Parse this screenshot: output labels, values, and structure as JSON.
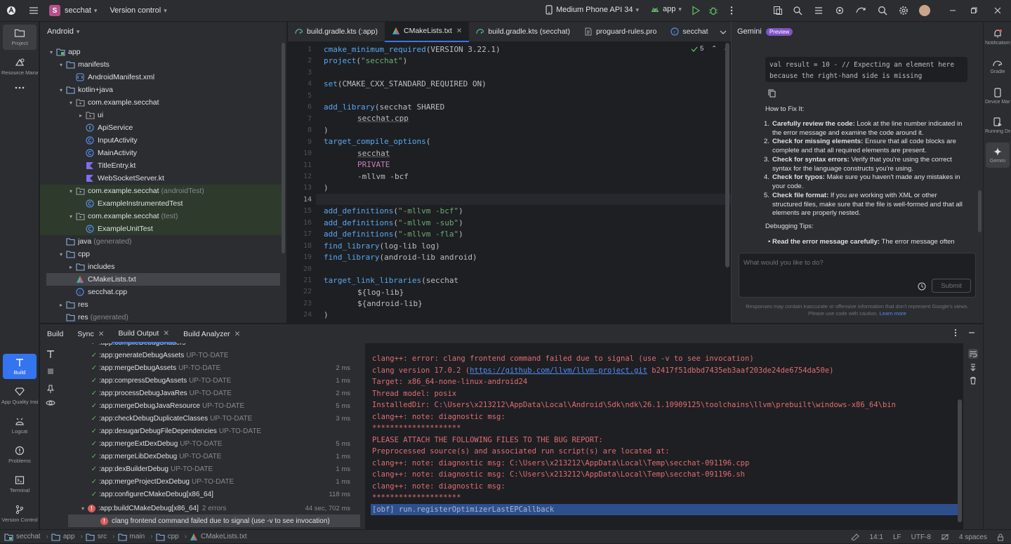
{
  "titlebar": {
    "project_initial": "S",
    "project_name": "secchat",
    "vcs_label": "Version control",
    "device": "Medium Phone API 34",
    "run_config": "app"
  },
  "left_strip": {
    "project": "Project",
    "resource_manager": "Resource Manager",
    "build": "Build",
    "app_quality": "App Quality Insights",
    "logcat": "Logcat",
    "problems": "Problems",
    "terminal": "Terminal",
    "version_control": "Version Control"
  },
  "project_panel": {
    "view_mode": "Android",
    "tree": [
      {
        "label": "app",
        "suffix": "",
        "depth": 0,
        "arrow": "down",
        "icon": "module"
      },
      {
        "label": "manifests",
        "suffix": "",
        "depth": 1,
        "arrow": "down",
        "icon": "folder"
      },
      {
        "label": "AndroidManifest.xml",
        "suffix": "",
        "depth": 2,
        "arrow": "",
        "icon": "xml"
      },
      {
        "label": "kotlin+java",
        "suffix": "",
        "depth": 1,
        "arrow": "down",
        "icon": "folder"
      },
      {
        "label": "com.example.secchat",
        "suffix": "",
        "depth": 2,
        "arrow": "down",
        "icon": "package"
      },
      {
        "label": "ui",
        "suffix": "",
        "depth": 3,
        "arrow": "right",
        "icon": "package"
      },
      {
        "label": "ApiService",
        "suffix": "",
        "depth": 3,
        "arrow": "",
        "icon": "interface"
      },
      {
        "label": "InputActivity",
        "suffix": "",
        "depth": 3,
        "arrow": "",
        "icon": "class"
      },
      {
        "label": "MainActivity",
        "suffix": "",
        "depth": 3,
        "arrow": "",
        "icon": "class"
      },
      {
        "label": "TitleEntry.kt",
        "suffix": "",
        "depth": 3,
        "arrow": "",
        "icon": "kt"
      },
      {
        "label": "WebSocketServer.kt",
        "suffix": "",
        "depth": 3,
        "arrow": "",
        "icon": "kt"
      },
      {
        "label": "com.example.secchat",
        "suffix": "(androidTest)",
        "depth": 2,
        "arrow": "down",
        "icon": "package",
        "test": true
      },
      {
        "label": "ExampleInstrumentedTest",
        "suffix": "",
        "depth": 3,
        "arrow": "",
        "icon": "class",
        "test": true
      },
      {
        "label": "com.example.secchat",
        "suffix": "(test)",
        "depth": 2,
        "arrow": "down",
        "icon": "package",
        "test": true
      },
      {
        "label": "ExampleUnitTest",
        "suffix": "",
        "depth": 3,
        "arrow": "",
        "icon": "class",
        "test": true
      },
      {
        "label": "java",
        "suffix": "(generated)",
        "depth": 1,
        "arrow": "",
        "icon": "folder"
      },
      {
        "label": "cpp",
        "suffix": "",
        "depth": 1,
        "arrow": "down",
        "icon": "folder"
      },
      {
        "label": "includes",
        "suffix": "",
        "depth": 2,
        "arrow": "right",
        "icon": "folder"
      },
      {
        "label": "CMakeLists.txt",
        "suffix": "",
        "depth": 2,
        "arrow": "",
        "icon": "cmake",
        "selected": true
      },
      {
        "label": "secchat.cpp",
        "suffix": "",
        "depth": 2,
        "arrow": "",
        "icon": "cpp"
      },
      {
        "label": "res",
        "suffix": "",
        "depth": 1,
        "arrow": "right",
        "icon": "folder"
      },
      {
        "label": "res",
        "suffix": "(generated)",
        "depth": 1,
        "arrow": "",
        "icon": "folder"
      }
    ]
  },
  "editor": {
    "tabs": [
      {
        "label": "build.gradle.kts (:app)",
        "icon": "gradle",
        "active": false,
        "close": false
      },
      {
        "label": "CMakeLists.txt",
        "icon": "cmake",
        "active": true,
        "close": true
      },
      {
        "label": "build.gradle.kts (secchat)",
        "icon": "gradle",
        "active": false,
        "close": false
      },
      {
        "label": "proguard-rules.pro",
        "icon": "file",
        "active": false,
        "close": false
      },
      {
        "label": "secchat",
        "icon": "cpp",
        "active": false,
        "close": false
      }
    ],
    "inspection_count": "5",
    "lines": [
      "1",
      "2",
      "3",
      "4",
      "5",
      "6",
      "7",
      "8",
      "9",
      "10",
      "11",
      "12",
      "13",
      "14",
      "15",
      "16",
      "17",
      "18",
      "19",
      "20",
      "21",
      "22",
      "23",
      "24"
    ],
    "code": {
      "l1_fn": "cmake_minimum_required",
      "l1_rest": "(VERSION 3.22.1)",
      "l2_fn": "project",
      "l2_str": "\"secchat\"",
      "l4_fn": "set",
      "l4_rest": "(CMAKE_CXX_STANDARD_REQUIRED ON)",
      "l6_fn": "add_library",
      "l6_rest": "(secchat SHARED",
      "l7": "secchat.cpp",
      "l8": ")",
      "l9_fn": "target_compile_options",
      "l9_rest": "(",
      "l10": "secchat",
      "l11": "PRIVATE",
      "l12": "-mllvm -bcf",
      "l13": ")",
      "l15_fn": "add_definitions",
      "l15_str": "\"-mllvm -bcf\"",
      "l16_fn": "add_definitions",
      "l16_str": "\"-mllvm -sub\"",
      "l17_fn": "add_definitions",
      "l17_str": "\"-mllvm -fla\"",
      "l18_fn": "find_library",
      "l18_rest": "(log-lib log)",
      "l19_fn": "find_library",
      "l19_rest": "(android-lib android)",
      "l21_fn": "target_link_libraries",
      "l21_rest": "(secchat",
      "l22": "${log-lib}",
      "l23": "${android-lib}",
      "l24": ")"
    }
  },
  "gemini": {
    "title": "Gemini",
    "badge": "Preview",
    "code_line1": "val result = 10 - // Expecting an element here",
    "code_line2": "because the right-hand side is missing",
    "how_to_fix": "How to Fix It:",
    "steps": [
      {
        "n": "1.",
        "bold": "Carefully review the code:",
        "text": " Look at the line number indicated in the error message and examine the code around it."
      },
      {
        "n": "2.",
        "bold": "Check for missing elements:",
        "text": " Ensure that all code blocks are complete and that all required elements are present."
      },
      {
        "n": "3.",
        "bold": "Check for syntax errors:",
        "text": " Verify that you're using the correct syntax for the language constructs you're using."
      },
      {
        "n": "4.",
        "bold": "Check for typos:",
        "text": " Make sure you haven't made any mistakes in your code."
      },
      {
        "n": "5.",
        "bold": "Check file format:",
        "text": " If you are working with XML or other structured files, make sure that the file is well-formed and that all elements are properly nested."
      }
    ],
    "debugging_tips": "Debugging Tips:",
    "tip1_bold": "Read the error message carefully:",
    "tip1_text": " The error message often",
    "input_placeholder": "What would you like to do?",
    "submit": "Submit",
    "disclaimer": "Responses may contain inaccurate or offensive information that don't represent Google's views. Please use code with caution.",
    "learn_more": "Learn more"
  },
  "right_strip": {
    "notifications": "Notifications",
    "gradle": "Gradle",
    "device_manager": "Device Manager",
    "running_devices": "Running Devices",
    "gemini": "Gemini"
  },
  "build": {
    "tabs": [
      {
        "label": "Build",
        "active": false,
        "close": false
      },
      {
        "label": "Sync",
        "active": false,
        "close": true
      },
      {
        "label": "Build Output",
        "active": true,
        "close": true
      },
      {
        "label": "Build Analyzer",
        "active": false,
        "close": true
      }
    ],
    "tasks": [
      {
        "name": ":app:compileDebugShaders",
        "status": "",
        "dur": ""
      },
      {
        "name": ":app:generateDebugAssets",
        "status": "UP-TO-DATE",
        "dur": ""
      },
      {
        "name": ":app:mergeDebugAssets",
        "status": "UP-TO-DATE",
        "dur": "2 ms"
      },
      {
        "name": ":app:compressDebugAssets",
        "status": "UP-TO-DATE",
        "dur": "1 ms"
      },
      {
        "name": ":app:processDebugJavaRes",
        "status": "UP-TO-DATE",
        "dur": "2 ms"
      },
      {
        "name": ":app:mergeDebugJavaResource",
        "status": "UP-TO-DATE",
        "dur": "5 ms"
      },
      {
        "name": ":app:checkDebugDuplicateClasses",
        "status": "UP-TO-DATE",
        "dur": "3 ms"
      },
      {
        "name": ":app:desugarDebugFileDependencies",
        "status": "UP-TO-DATE",
        "dur": ""
      },
      {
        "name": ":app:mergeExtDexDebug",
        "status": "UP-TO-DATE",
        "dur": "5 ms"
      },
      {
        "name": ":app:mergeLibDexDebug",
        "status": "UP-TO-DATE",
        "dur": "1 ms"
      },
      {
        "name": ":app:dexBuilderDebug",
        "status": "UP-TO-DATE",
        "dur": "1 ms"
      },
      {
        "name": ":app:mergeProjectDexDebug",
        "status": "UP-TO-DATE",
        "dur": "1 ms"
      },
      {
        "name": ":app:configureCMakeDebug[x86_64]",
        "status": "",
        "dur": "118 ms"
      }
    ],
    "failed_task": ":app:buildCMakeDebug[x86_64]",
    "failed_count": "2 errors",
    "failed_dur": "44 sec, 702 ms",
    "error_item": "clang frontend command failed due to signal (use -v to see invocation)",
    "console": [
      "clang++: error: clang frontend command failed due to signal (use -v to see invocation)",
      "Target: x86_64-none-linux-android24",
      "Thread model: posix",
      "InstalledDir: C:\\Users\\x213212\\AppData\\Local\\Android\\Sdk\\ndk\\26.1.10909125\\toolchains\\llvm\\prebuilt\\windows-x86_64\\bin",
      "clang++: note: diagnostic msg:",
      "********************",
      "PLEASE ATTACH THE FOLLOWING FILES TO THE BUG REPORT:",
      "Preprocessed source(s) and associated run script(s) are located at:",
      "clang++: note: diagnostic msg: C:\\Users\\x213212\\AppData\\Local\\Temp\\secchat-091196.cpp",
      "clang++: note: diagnostic msg: C:\\Users\\x213212\\AppData\\Local\\Temp\\secchat-091196.sh",
      "clang++: note: diagnostic msg:",
      "********************",
      "[obf] run.registerOptimizerLastEPCallback"
    ],
    "clang_version_prefix": "clang version 17.0.2 (",
    "clang_version_link": "https://github.com/llvm/llvm-project.git",
    "clang_version_suffix": " b2417f51dbbd7435eb3aaf203de24de6754da50e)"
  },
  "statusbar": {
    "crumbs": [
      "secchat",
      "app",
      "src",
      "main",
      "cpp",
      "CMakeLists.txt"
    ],
    "position": "14:1",
    "line_sep": "LF",
    "encoding": "UTF-8",
    "indent": "4 spaces"
  },
  "colors": {
    "accent": "#3574f0",
    "error": "#db5c5c",
    "success": "#5fb865"
  }
}
